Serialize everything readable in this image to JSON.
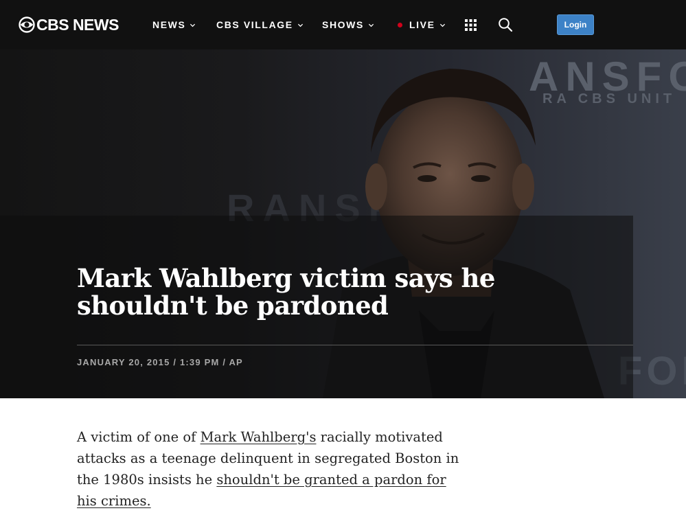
{
  "nav": {
    "logo": "CBS NEWS",
    "items": [
      {
        "label": "NEWS"
      },
      {
        "label": "CBS VILLAGE"
      },
      {
        "label": "SHOWS"
      },
      {
        "label": "LIVE"
      }
    ],
    "login_label": "Login",
    "live_dot_color": "#d0021b",
    "login_color": "#3d82c7"
  },
  "hero": {
    "backdrop_text_top": "ANSFOR",
    "backdrop_text_sub": "RA CBS UNIT",
    "backdrop_text_mid": "RANSF",
    "backdrop_text_side": "FOR",
    "headline": "Mark Wahlberg victim says he shouldn't be pardoned",
    "byline": "JANUARY 20, 2015 / 1:39 PM / AP"
  },
  "article": {
    "p1_before": "A victim of one of ",
    "p1_link1": "Mark Wahlberg's",
    "p1_middle": " racially motivated attacks as a teenage delinquent in segregated Boston in the 1980s insists he ",
    "p1_link2": "shouldn't be granted a pardon for his crimes."
  }
}
